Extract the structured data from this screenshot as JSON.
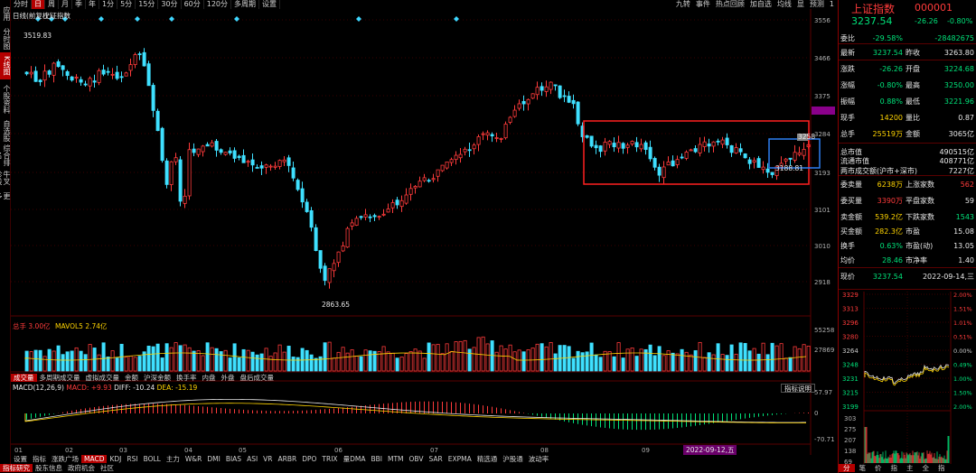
{
  "left_nav": [
    "应用",
    "分时图",
    "K线图",
    "个股资料",
    "自选股",
    "综合排名",
    "牛叉诊股",
    "更多"
  ],
  "period_tabs": [
    "分时",
    "日",
    "周",
    "月",
    "季",
    "年",
    "1分",
    "5分",
    "15分",
    "30分",
    "60分",
    "120分",
    "多周期",
    "设置"
  ],
  "top_tools": [
    "九转",
    "事件",
    "热点回顾",
    "加自选",
    "均线",
    "显",
    "预测",
    "1"
  ],
  "chart_header": {
    "left": "日线(前复权)",
    "name": "上证指数"
  },
  "price_axis": [
    "3556",
    "3466",
    "3375",
    "3339",
    "3284",
    "3193",
    "3101",
    "3010",
    "2918"
  ],
  "price_annotations": {
    "high": "3519.83",
    "low": "2863.65",
    "mid_low": "3188.81",
    "mid_right": "3258",
    "mid_right2": "3294"
  },
  "volume_header": {
    "label": "总手",
    "value": "3.00亿",
    "ma_label": "MAVOL5",
    "ma_value": "2.74亿"
  },
  "volume_axis": [
    "55258",
    "27869"
  ],
  "sub_tabs": [
    "成交量",
    "多周期成交量",
    "虚拟成交量",
    "金额",
    "沪深金额",
    "换手率",
    "内盘",
    "外盘",
    "盘后成交量"
  ],
  "macd_header": {
    "label": "MACD(12,26,9)",
    "macd": "MACD: +9.93",
    "diff": "DIFF: -10.24",
    "dea": "DEA: -15.19"
  },
  "macd_axis": [
    "57.97",
    "0",
    "-70.71"
  ],
  "macd_button": "指标说明",
  "months": [
    "01",
    "02",
    "03",
    "04",
    "05",
    "06",
    "07",
    "08",
    "09"
  ],
  "date_tag": "2022-09-12,五",
  "indicators": [
    "设置",
    "指标",
    "涨跌广场",
    "MACD",
    "KDJ",
    "RSI",
    "BOLL",
    "主力",
    "W&R",
    "DMI",
    "BIAS",
    "ASI",
    "VR",
    "ARBR",
    "DPO",
    "TRIX",
    "量DMA",
    "BBI",
    "MTM",
    "OBV",
    "SAR",
    "EXPMA",
    "精选通",
    "沪股通",
    "波动率"
  ],
  "bottom_nav": [
    "指标研究",
    "股东信息",
    "政府机会",
    "社区"
  ],
  "right_panel": {
    "title": "上证指数",
    "code": "000001",
    "price": "3237.54",
    "change": "-26.26",
    "pct": "-0.80%",
    "rows": [
      {
        "l1": "委比",
        "v1": "-29.58%",
        "l2": "",
        "v2": "-28482675"
      },
      {
        "l1": "最新",
        "v1": "3237.54",
        "l2": "昨收",
        "v2": "3263.80"
      },
      {
        "l1": "涨跌",
        "v1": "-26.26",
        "l2": "开盘",
        "v2": "3224.68"
      },
      {
        "l1": "涨幅",
        "v1": "-0.80%",
        "l2": "最高",
        "v2": "3250.00"
      },
      {
        "l1": "振幅",
        "v1": "0.88%",
        "l2": "最低",
        "v2": "3221.96"
      },
      {
        "l1": "现手",
        "v1": "14200",
        "l2": "量比",
        "v2": "0.87"
      },
      {
        "l1": "总手",
        "v1": "25519万",
        "l2": "金额",
        "v2": "3065亿"
      },
      {
        "l1": "总市值",
        "v1": "",
        "l2": "",
        "v2": "490515亿"
      },
      {
        "l1": "流通市值",
        "v1": "",
        "l2": "",
        "v2": "408771亿"
      },
      {
        "l1": "两市成交额(沪市+深市)",
        "v1": "",
        "l2": "",
        "v2": "7227亿"
      },
      {
        "l1": "委卖量",
        "v1": "6238万",
        "l2": "上涨家数",
        "v2": "562"
      },
      {
        "l1": "委买量",
        "v1": "3390万",
        "l2": "平盘家数",
        "v2": "59"
      },
      {
        "l1": "卖金额",
        "v1": "539.2亿",
        "l2": "下跌家数",
        "v2": "1543"
      },
      {
        "l1": "买金额",
        "v1": "282.3亿",
        "l2": "市盈",
        "v2": "15.08"
      },
      {
        "l1": "换手",
        "v1": "0.63%",
        "l2": "市盈(动)",
        "v2": "13.05"
      },
      {
        "l1": "均价",
        "v1": "28.46",
        "l2": "市净率",
        "v2": "1.40"
      },
      {
        "l1": "现价",
        "v1": "3237.54",
        "l2": "",
        "v2": "2022-09-14,三"
      }
    ],
    "mini_left_axis": [
      "3329",
      "3313",
      "3296",
      "3280",
      "3264",
      "3248",
      "3231",
      "3215",
      "3199"
    ],
    "mini_right_axis": [
      "2.00%",
      "1.51%",
      "1.01%",
      "0.51%",
      "0.00%",
      "0.49%",
      "1.00%",
      "1.50%",
      "2.00%"
    ],
    "mini_vol_axis": [
      "303",
      "275",
      "207",
      "138",
      "69"
    ],
    "bottom_tabs": [
      "分",
      "笔",
      "价",
      "指",
      "主",
      "全",
      "指"
    ]
  },
  "candle_colors": {
    "up": "#ff3b3b",
    "down": "#3fe0ff"
  }
}
